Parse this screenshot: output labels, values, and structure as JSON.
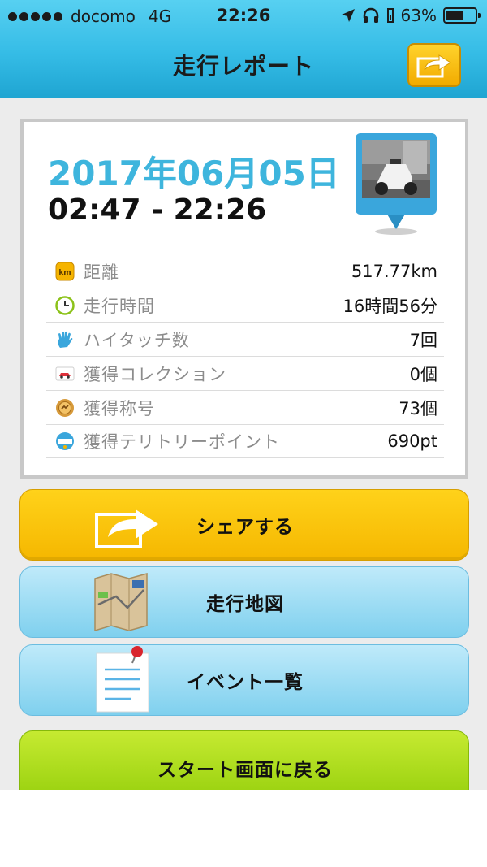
{
  "status_bar": {
    "carrier": "docomo",
    "network": "4G",
    "time": "22:26",
    "battery": "63%",
    "battery_level": 0.63
  },
  "nav": {
    "title": "走行レポート",
    "share_icon": "share-arrow-icon"
  },
  "report": {
    "date": "2017年06月05日",
    "time_range": "02:47 - 22:26",
    "photo_icon": "motorcycle-photo-pin",
    "stats": [
      {
        "icon": "km-icon",
        "label": "距離",
        "value": "517.77km"
      },
      {
        "icon": "clock-icon",
        "label": "走行時間",
        "value": "16時間56分"
      },
      {
        "icon": "hand-icon",
        "label": "ハイタッチ数",
        "value": "7回"
      },
      {
        "icon": "car-card-icon",
        "label": "獲得コレクション",
        "value": "0個"
      },
      {
        "icon": "medal-icon",
        "label": "獲得称号",
        "value": "73個"
      },
      {
        "icon": "spot-icon",
        "label": "獲得テリトリーポイント",
        "value": "690pt"
      }
    ]
  },
  "buttons": {
    "share": "シェアする",
    "map": "走行地図",
    "events": "イベント一覧",
    "start": "スタート画面に戻る"
  },
  "colors": {
    "header": "#35bce6",
    "date": "#3eb5dd",
    "share_button": "#f5b700",
    "blue_button": "#7fd0ee",
    "start_button": "#95cf0c"
  }
}
